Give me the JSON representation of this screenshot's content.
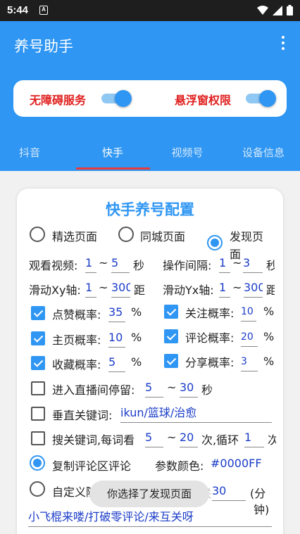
{
  "status_bar": {
    "time": "5:44",
    "notification_icon": "A",
    "wifi_icon": "wifi-icon",
    "signal_icon": "signal-icon",
    "battery_icon": "battery-icon"
  },
  "app_bar": {
    "title": "养号助手",
    "menu_icon": "more-vertical-icon"
  },
  "permissions": {
    "accessibility_label": "无障碍服务",
    "accessibility_on": true,
    "overlay_label": "悬浮窗权限",
    "overlay_on": true
  },
  "tabs": [
    {
      "label": "抖音",
      "active": false
    },
    {
      "label": "快手",
      "active": true
    },
    {
      "label": "视频号",
      "active": false
    },
    {
      "label": "设备信息",
      "active": false
    }
  ],
  "config": {
    "title": "快手养号配置",
    "page_options": [
      {
        "label": "精选页面",
        "selected": false
      },
      {
        "label": "同城页面",
        "selected": false
      },
      {
        "label": "发现页面",
        "selected": true
      }
    ],
    "page_label_line1": "发现页",
    "page_label_line2": "面",
    "watch_video": {
      "label": "观看视频:",
      "min": "1",
      "tilde": "~",
      "max": "5",
      "unit": "秒"
    },
    "op_interval": {
      "label": "操作间隔:",
      "min": "1",
      "tilde": "~",
      "max": "3",
      "unit": "秒"
    },
    "swipe_x": {
      "label": "滑动Xy轴:",
      "min": "1",
      "tilde": "~",
      "max": "300",
      "unit": "距"
    },
    "swipe_y": {
      "label": "滑动Yx轴:",
      "min": "1",
      "tilde": "~",
      "max": "300",
      "unit": "距"
    },
    "like_rate": {
      "label": "点赞概率:",
      "value": "35",
      "unit": "%",
      "checked": true
    },
    "follow_rate": {
      "label": "关注概率:",
      "value": "10",
      "unit": "%",
      "checked": true
    },
    "home_rate": {
      "label": "主页概率:",
      "value": "10",
      "unit": "%",
      "checked": true
    },
    "comment_rate": {
      "label": "评论概率:",
      "value": "20",
      "unit": "%",
      "checked": true
    },
    "fav_rate": {
      "label": "收藏概率:",
      "value": "5",
      "unit": "%",
      "checked": true
    },
    "share_rate": {
      "label": "分享概率:",
      "value": "3",
      "unit": "%",
      "checked": true
    },
    "live_stay": {
      "label": "进入直播间停留:",
      "min": "5",
      "tilde": "~",
      "max": "30",
      "unit": "秒",
      "checked": false
    },
    "vertical_keyword": {
      "label": "垂直关键词:",
      "value": "ikun/篮球/治愈",
      "checked": false
    },
    "search_keyword": {
      "label": "搜关键词,每词看",
      "min": "5",
      "tilde": "~",
      "max": "20",
      "mid": "次,循环",
      "loop": "1",
      "unit": "次",
      "checked": false
    },
    "copy_comment": {
      "label": "复制评论区评论",
      "selected": true
    },
    "param_color": {
      "label": "参数颜色:",
      "value": "#0000FF"
    },
    "custom": {
      "label": "自定义随机",
      "partial": "联",
      "value": "30",
      "unit_line1": "(分",
      "unit_line2": "钟)",
      "selected": false
    },
    "comment_text": "小飞棍来喽/打破零评论/来互关呀"
  },
  "toast": "你选择了发现页面"
}
